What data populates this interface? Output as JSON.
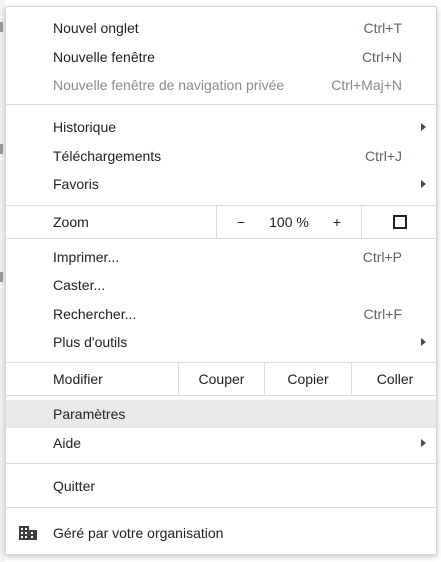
{
  "menu": {
    "group1": [
      {
        "label": "Nouvel onglet",
        "shortcut": "Ctrl+T"
      },
      {
        "label": "Nouvelle fenêtre",
        "shortcut": "Ctrl+N"
      },
      {
        "label": "Nouvelle fenêtre de navigation privée",
        "shortcut": "Ctrl+Maj+N"
      }
    ],
    "group2": [
      {
        "label": "Historique"
      },
      {
        "label": "Téléchargements",
        "shortcut": "Ctrl+J"
      },
      {
        "label": "Favoris"
      }
    ],
    "zoom": {
      "label": "Zoom",
      "minus": "−",
      "value": "100 %",
      "plus": "+"
    },
    "group3": [
      {
        "label": "Imprimer...",
        "shortcut": "Ctrl+P"
      },
      {
        "label": "Caster..."
      },
      {
        "label": "Rechercher...",
        "shortcut": "Ctrl+F"
      },
      {
        "label": "Plus d'outils"
      }
    ],
    "edit": {
      "label": "Modifier",
      "cut": "Couper",
      "copy": "Copier",
      "paste": "Coller"
    },
    "group4": [
      {
        "label": "Paramètres"
      },
      {
        "label": "Aide"
      }
    ],
    "quit": {
      "label": "Quitter"
    },
    "managed": {
      "label": "Géré par votre organisation"
    }
  },
  "colors": {
    "hover_bg": "#e9e9e9",
    "separator": "#dadce0",
    "text": "#202124",
    "disabled_text": "#8a8a8a"
  }
}
